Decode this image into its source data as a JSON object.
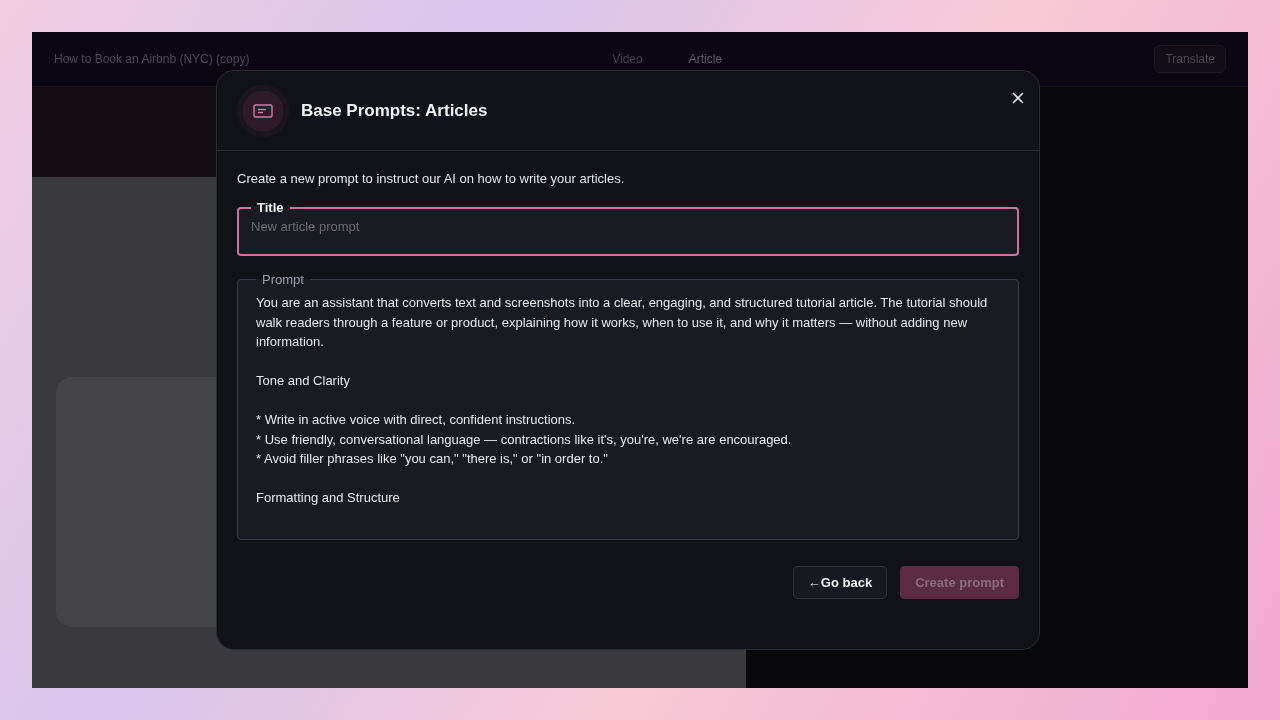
{
  "background_app": {
    "document_title": "How to Book an Airbnb (NYC) (copy)",
    "view_tabs": [
      {
        "label": "Video",
        "selected": false
      },
      {
        "label": "Article",
        "selected": true
      }
    ],
    "translate_button": "Translate"
  },
  "dialog": {
    "title": "Base Prompts: Articles",
    "description": "Create a new prompt to instruct our AI on how to write your articles.",
    "title_field": {
      "label": "Title",
      "placeholder": "New article prompt",
      "focused": true
    },
    "prompt_field": {
      "label": "Prompt",
      "value": "You are an assistant that converts text and screenshots into a clear, engaging, and structured tutorial article. The tutorial should walk readers through a feature or product, explaining how it works, when to use it, and why it matters — without adding new information.\n\nTone and Clarity\n\n* Write in active voice with direct, confident instructions.\n* Use friendly, conversational language — contractions like it's, you're, we're are encouraged.\n* Avoid filler phrases like \"you can,\" \"there is,\" or \"in order to.\"\n\nFormatting and Structure",
      "focused": false
    },
    "buttons": [
      {
        "label": "←Go back",
        "kind": "secondary",
        "disabled": false
      },
      {
        "label": "Create prompt",
        "kind": "primary",
        "disabled": true
      }
    ]
  }
}
